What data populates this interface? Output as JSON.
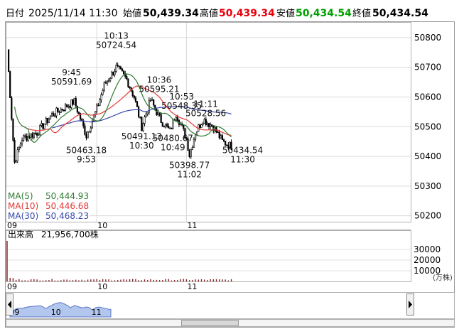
{
  "header": {
    "label_datetime": "日付",
    "datetime": "2025/11/14 11:30",
    "label_open": "始値",
    "open": "50,439.34",
    "label_high": "高値",
    "high": "50,439.34",
    "label_low": "安値",
    "low": "50,434.54",
    "label_close": "終値",
    "close": "50,434.54"
  },
  "colors": {
    "high": "#e8000b",
    "low": "#00a000",
    "ma5": "#2e7d32",
    "ma10": "#e53935",
    "ma30": "#3949ab",
    "candle": "#000000",
    "volume": "#8a1a1a",
    "navigator_fill": "#b3c6ee",
    "navigator_line": "#5b78c8"
  },
  "moving_averages": [
    {
      "label": "MA(5)",
      "value": "50,444.93"
    },
    {
      "label": "MA(10)",
      "value": "50,446.68"
    },
    {
      "label": "MA(30)",
      "value": "50,468.23"
    }
  ],
  "volume_panel": {
    "title": "出来高",
    "total": "21,956,700株",
    "unit": "(万株)"
  },
  "chart_data": {
    "type": "candlestick",
    "title": "",
    "x_ticks": [
      "09",
      "10",
      "11"
    ],
    "y_ticks": [
      50200,
      50300,
      50400,
      50500,
      50600,
      50700,
      50800
    ],
    "ylim": [
      50180,
      50850
    ],
    "annotations": [
      {
        "time": "9:45",
        "value": "50591.69"
      },
      {
        "time": "10:13",
        "value": "50724.54"
      },
      {
        "time": "10:36",
        "value": "50595.21"
      },
      {
        "time": "10:53",
        "value": "50548.35"
      },
      {
        "time": "11:11",
        "value": "50528.56"
      },
      {
        "time": "9:53",
        "value": "50463.18"
      },
      {
        "time": "10:30",
        "value": "50491.13"
      },
      {
        "time": "10:49",
        "value": "50480.67"
      },
      {
        "time": "11:02",
        "value": "50398.77"
      },
      {
        "time": "11:30",
        "value": "50434.54"
      }
    ],
    "approx_close_path": [
      {
        "time": "09:00",
        "value": 50760
      },
      {
        "time": "09:05",
        "value": 50380
      },
      {
        "time": "09:10",
        "value": 50460
      },
      {
        "time": "09:20",
        "value": 50480
      },
      {
        "time": "09:30",
        "value": 50540
      },
      {
        "time": "09:40",
        "value": 50570
      },
      {
        "time": "09:45",
        "value": 50585
      },
      {
        "time": "09:53",
        "value": 50470
      },
      {
        "time": "10:00",
        "value": 50560
      },
      {
        "time": "10:05",
        "value": 50640
      },
      {
        "time": "10:13",
        "value": 50700
      },
      {
        "time": "10:20",
        "value": 50660
      },
      {
        "time": "10:25",
        "value": 50600
      },
      {
        "time": "10:30",
        "value": 50500
      },
      {
        "time": "10:36",
        "value": 50590
      },
      {
        "time": "10:43",
        "value": 50520
      },
      {
        "time": "10:49",
        "value": 50485
      },
      {
        "time": "10:53",
        "value": 50545
      },
      {
        "time": "11:00",
        "value": 50460
      },
      {
        "time": "11:02",
        "value": 50405
      },
      {
        "time": "11:06",
        "value": 50480
      },
      {
        "time": "11:11",
        "value": 50525
      },
      {
        "time": "11:18",
        "value": 50500
      },
      {
        "time": "11:24",
        "value": 50450
      },
      {
        "time": "11:30",
        "value": 50434.54
      }
    ],
    "volume_ticks": [
      10000,
      20000,
      30000
    ],
    "volume_ylim": [
      0,
      40000
    ]
  }
}
